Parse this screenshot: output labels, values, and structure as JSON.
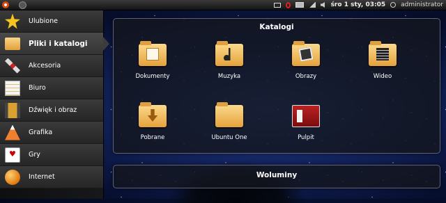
{
  "top_panel": {
    "clock": "śro 1 sty, 03:05",
    "user": "administrator"
  },
  "sidebar": {
    "items": [
      {
        "label": "Ulubione",
        "icon": "star-icon"
      },
      {
        "label": "Pliki i katalogi",
        "icon": "folder-icon",
        "active": true
      },
      {
        "label": "Akcesoria",
        "icon": "tools-icon"
      },
      {
        "label": "Biuro",
        "icon": "office-icon"
      },
      {
        "label": "Dźwięk i obraz",
        "icon": "media-icon"
      },
      {
        "label": "Grafika",
        "icon": "graphics-icon"
      },
      {
        "label": "Gry",
        "icon": "cards-icon"
      },
      {
        "label": "Internet",
        "icon": "globe-icon"
      }
    ]
  },
  "catalogs": {
    "title": "Katalogi",
    "items": [
      {
        "label": "Dokumenty",
        "icon": "documents-folder-icon"
      },
      {
        "label": "Muzyka",
        "icon": "music-folder-icon"
      },
      {
        "label": "Obrazy",
        "icon": "pictures-folder-icon"
      },
      {
        "label": "Wideo",
        "icon": "videos-folder-icon"
      },
      {
        "label": "Pobrane",
        "icon": "downloads-folder-icon"
      },
      {
        "label": "Ubuntu One",
        "icon": "ubuntu-one-folder-icon"
      },
      {
        "label": "Pulpit",
        "icon": "desktop-icon"
      }
    ]
  },
  "volumes": {
    "title": "Woluminy"
  }
}
